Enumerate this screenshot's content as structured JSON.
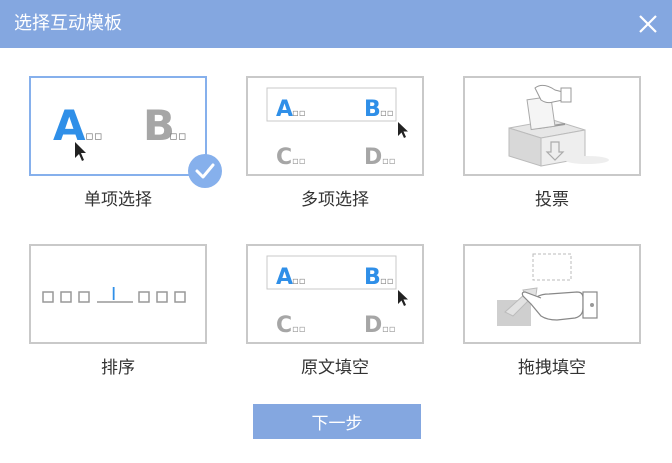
{
  "dialog": {
    "title": "选择互动模板"
  },
  "templates": [
    {
      "label": "单项选择",
      "selected": true
    },
    {
      "label": "多项选择",
      "selected": false
    },
    {
      "label": "投票",
      "selected": false
    },
    {
      "label": "排序",
      "selected": false
    },
    {
      "label": "原文填空",
      "selected": false
    },
    {
      "label": "拖拽填空",
      "selected": false
    }
  ],
  "card_text": {
    "option_a": "A",
    "option_b": "B",
    "option_c": "C",
    "option_d": "D",
    "small_dots": "▫▫",
    "cursor_i": "I"
  },
  "footer": {
    "next_label": "下一步"
  },
  "colors": {
    "titlebar": "#84a7e0",
    "accent_blue": "#2f8fe8",
    "gray_letter": "#a6a6a6",
    "selected_border": "#86b0ec"
  },
  "icons": {
    "close": "close-icon",
    "check": "check-circle-icon",
    "cursor": "mouse-pointer-icon",
    "ballot": "ballot-box-icon",
    "drag_hand": "drag-hand-icon"
  }
}
